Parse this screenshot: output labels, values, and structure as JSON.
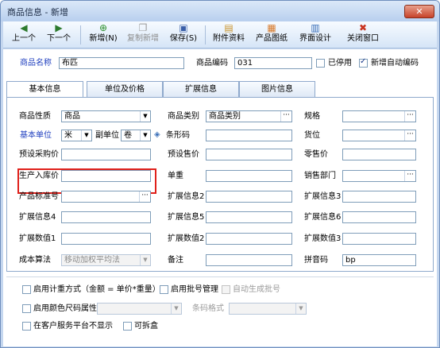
{
  "window": {
    "title": "商品信息 - 新增"
  },
  "toolbar": {
    "prev": "上一个",
    "next": "下一个",
    "add": "新增(N)",
    "copy_add": "复制新增",
    "save": "保存(S)",
    "attachments": "附件资料",
    "product_image": "产品图纸",
    "ui_design": "界面设计",
    "close_window": "关闭窗口"
  },
  "header": {
    "name_label": "商品名称",
    "name_value": "布匹",
    "code_label": "商品编码",
    "code_value": "031",
    "disabled_label": "已停用",
    "auto_code_label": "新增自动编码"
  },
  "tabs": [
    "基本信息",
    "单位及价格",
    "扩展信息",
    "图片信息"
  ],
  "form": {
    "nature_label": "商品性质",
    "nature_value": "商品",
    "category_label": "商品类别",
    "category_value": "商品类别",
    "spec_label": "规格",
    "base_unit_label": "基本单位",
    "base_unit_value": "米",
    "sub_unit_label": "副单位",
    "sub_unit_value": "卷",
    "barcode_label": "条形码",
    "location_label": "货位",
    "pre_purchase_label": "预设采购价",
    "pre_sale_label": "预设售价",
    "retail_label": "零售价",
    "production_price_label": "生产入库价",
    "unit_weight_label": "单重",
    "sales_dept_label": "销售部门",
    "std_code_label": "产品标准号",
    "ext2_label": "扩展信息2",
    "ext3_label": "扩展信息3",
    "ext4_label": "扩展信息4",
    "ext5_label": "扩展信息5",
    "ext6_label": "扩展信息6",
    "extnum1_label": "扩展数值1",
    "extnum2_label": "扩展数值2",
    "extnum3_label": "扩展数值3",
    "cost_method_label": "成本算法",
    "cost_method_value": "移动加权平均法",
    "remark_label": "备注",
    "pinyin_label": "拼音码",
    "pinyin_value": "bp"
  },
  "options": {
    "weigh_mode": "启用计重方式（金额 = 单价*重量）",
    "batch_mgmt": "启用批号管理",
    "auto_batch": "自动生成批号",
    "color_size": "启用颜色尺码属性",
    "barcode_format": "条码格式",
    "hide_customer": "在客户服务平台不显示",
    "splittable": "可拆盒"
  }
}
